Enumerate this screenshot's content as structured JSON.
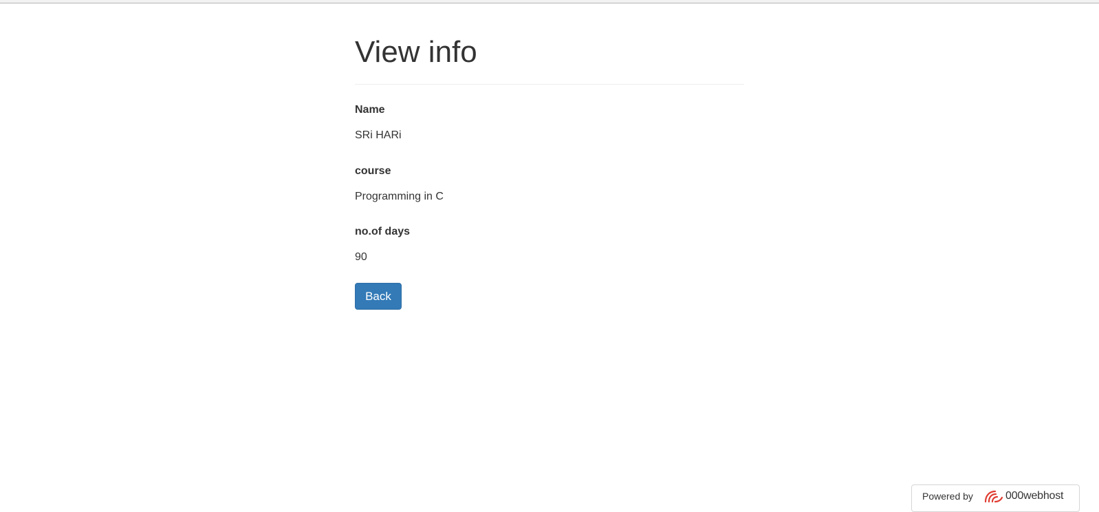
{
  "page": {
    "title": "View info"
  },
  "fields": [
    {
      "label": "Name",
      "value": "SRi HARi"
    },
    {
      "label": "course",
      "value": "Programming in C"
    },
    {
      "label": "no.of days",
      "value": "90"
    }
  ],
  "actions": {
    "back_label": "Back"
  },
  "footer": {
    "powered_by": "Powered by",
    "brand": "000webhost",
    "logo_icon": "000webhost-logo-icon"
  },
  "colors": {
    "primary_button": "#337ab7",
    "text": "#333333",
    "brand_logo": "#e03c31"
  }
}
